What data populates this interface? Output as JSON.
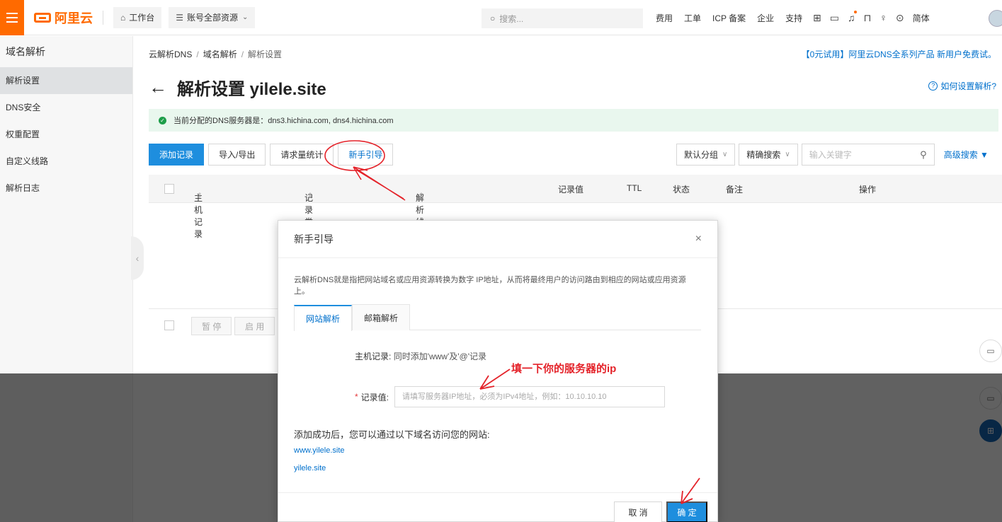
{
  "topbar": {
    "brand": "阿里云",
    "workbench": "工作台",
    "resources": "账号全部资源",
    "search_placeholder": "搜索...",
    "links": [
      "费用",
      "工单",
      "ICP 备案",
      "企业",
      "支持"
    ],
    "lang": "简体",
    "accent_color": "#ff6a00"
  },
  "sidebar": {
    "title": "域名解析",
    "items": [
      {
        "label": "解析设置",
        "active": true
      },
      {
        "label": "DNS安全"
      },
      {
        "label": "权重配置"
      },
      {
        "label": "自定义线路"
      },
      {
        "label": "解析日志"
      }
    ]
  },
  "breadcrumb": [
    "云解析DNS",
    "域名解析",
    "解析设置"
  ],
  "promo": "【0元试用】阿里云DNS全系列产品 新用户免费试。",
  "page_title": "解析设置 yilele.site",
  "help_link": "如何设置解析?",
  "dns_banner": "当前分配的DNS服务器是：dns3.hichina.com, dns4.hichina.com",
  "toolbar": {
    "add": "添加记录",
    "import_export": "导入/导出",
    "stats": "请求量统计",
    "guide": "新手引导"
  },
  "filters": {
    "group": "默认分组",
    "exact": "精确搜索",
    "keyword_placeholder": "输入关键字",
    "advanced": "高级搜索 ▼"
  },
  "table": {
    "columns": [
      "主机记录",
      "记录类型",
      "解析线路(isp)",
      "记录值",
      "TTL",
      "状态",
      "备注",
      "操作"
    ]
  },
  "bottom": {
    "pause": "暂 停",
    "enable": "启 用"
  },
  "modal": {
    "title": "新手引导",
    "desc": "云解析DNS就是指把网站域名或应用资源转换为数字 IP地址，从而将最终用户的访问路由到相应的网站或应用资源上。",
    "tabs": [
      "网站解析",
      "邮箱解析"
    ],
    "host_label": "主机记录:",
    "host_value": "同时添加'www'及'@'记录",
    "record_label": "记录值:",
    "record_placeholder": "请填写服务器IP地址，必须为IPv4地址，例如：10.10.10.10",
    "after_text": "添加成功后，您可以通过以下域名访问您的网站:",
    "links": [
      "www.yilele.site",
      "yilele.site"
    ],
    "cancel": "取 消",
    "ok": "确 定"
  },
  "annotation": {
    "text": "填一下你的服务器的ip",
    "color": "#e4232a"
  }
}
